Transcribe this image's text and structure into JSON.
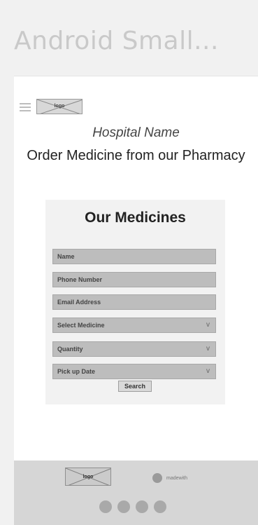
{
  "frame": {
    "title": "Android Small..."
  },
  "header": {
    "logo_label": "logo",
    "hospital_name": "Hospital Name",
    "heading": "Order Medicine from our Pharmacy"
  },
  "form": {
    "title": "Our Medicines",
    "fields": {
      "name": "Name",
      "phone": "Phone Number",
      "email": "Email Address",
      "medicine": "Select Medicine",
      "quantity": "Quantity",
      "pickup": "Pick up Date"
    },
    "chevron": "v",
    "search_label": "Search"
  },
  "footer": {
    "logo_label": "logo",
    "credit": "madewith"
  },
  "icons": {
    "menu": "menu-icon",
    "dropdown": "chevron-down-icon",
    "social": [
      "social-icon-1",
      "social-icon-2",
      "social-icon-3",
      "social-icon-4"
    ]
  },
  "colors": {
    "background": "#f1f1f1",
    "screen": "#ffffff",
    "card": "#f2f2f2",
    "field": "#bdbdbd",
    "footer": "#d6d6d6"
  }
}
